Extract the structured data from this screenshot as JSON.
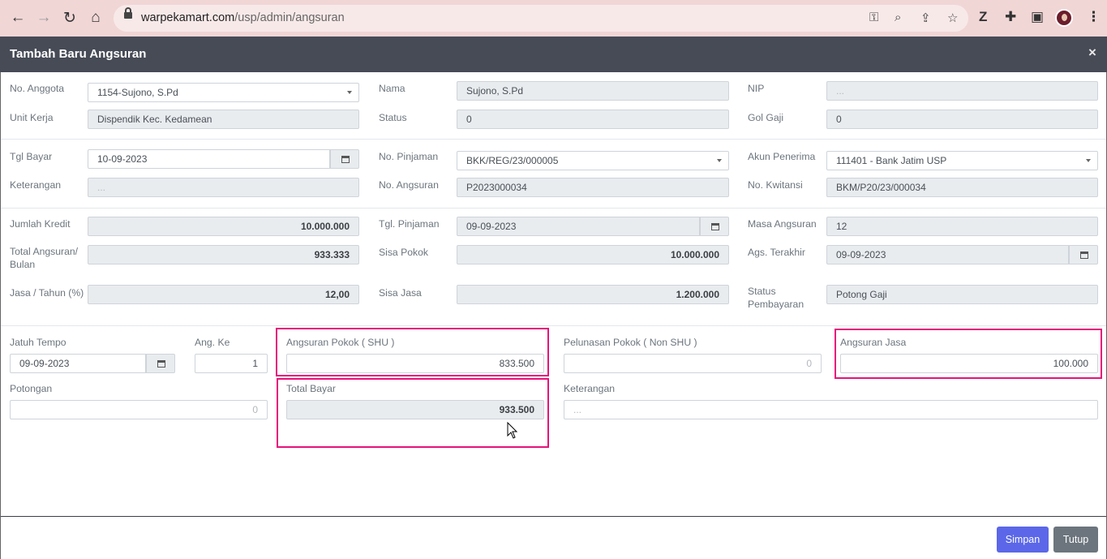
{
  "browser": {
    "url_domain": "warpekamart.com",
    "url_path": "/usp/admin/angsuran"
  },
  "modal": {
    "title": "Tambah Baru Angsuran",
    "close": "×"
  },
  "row1": {
    "no_anggota_label": "No. Anggota",
    "no_anggota_value": "1154-Sujono, S.Pd",
    "nama_label": "Nama",
    "nama_value": "Sujono, S.Pd",
    "nip_label": "NIP",
    "nip_value": "...",
    "unit_kerja_label": "Unit Kerja",
    "unit_kerja_value": "Dispendik Kec. Kedamean",
    "status_label": "Status",
    "status_value": "0",
    "gol_gaji_label": "Gol Gaji",
    "gol_gaji_value": "0"
  },
  "row2": {
    "tgl_bayar_label": "Tgl Bayar",
    "tgl_bayar_value": "10-09-2023",
    "no_pinjaman_label": "No. Pinjaman",
    "no_pinjaman_value": "BKK/REG/23/000005",
    "akun_penerima_label": "Akun Penerima",
    "akun_penerima_value": "111401 - Bank Jatim USP",
    "keterangan_label": "Keterangan",
    "keterangan_value": "...",
    "no_angsuran_label": "No. Angsuran",
    "no_angsuran_value": "P2023000034",
    "no_kwitansi_label": "No. Kwitansi",
    "no_kwitansi_value": "BKM/P20/23/000034"
  },
  "row3": {
    "jumlah_kredit_label": "Jumlah Kredit",
    "jumlah_kredit_value": "10.000.000",
    "tgl_pinjaman_label": "Tgl. Pinjaman",
    "tgl_pinjaman_value": "09-09-2023",
    "masa_angsuran_label": "Masa Angsuran",
    "masa_angsuran_value": "12",
    "total_angsuran_label": "Total Angsuran/ Bulan",
    "total_angsuran_value": "933.333",
    "sisa_pokok_label": "Sisa Pokok",
    "sisa_pokok_value": "10.000.000",
    "ags_terakhir_label": "Ags. Terakhir",
    "ags_terakhir_value": "09-09-2023",
    "jasa_tahun_label": "Jasa / Tahun (%)",
    "jasa_tahun_value": "12,00",
    "sisa_jasa_label": "Sisa Jasa",
    "sisa_jasa_value": "1.200.000",
    "status_pembayaran_label": "Status Pembayaran",
    "status_pembayaran_value": "Potong Gaji"
  },
  "row4": {
    "jatuh_tempo_label": "Jatuh Tempo",
    "jatuh_tempo_value": "09-09-2023",
    "ang_ke_label": "Ang. Ke",
    "ang_ke_value": "1",
    "angsuran_pokok_label": "Angsuran Pokok ( SHU )",
    "angsuran_pokok_value": "833.500",
    "pelunasan_pokok_label": "Pelunasan Pokok ( Non SHU )",
    "pelunasan_pokok_value": "0",
    "angsuran_jasa_label": "Angsuran Jasa",
    "angsuran_jasa_value": "100.000",
    "potongan_label": "Potongan",
    "potongan_value": "0",
    "total_bayar_label": "Total Bayar",
    "total_bayar_value": "933.500",
    "keterangan_label": "Keterangan",
    "keterangan_value": "..."
  },
  "footer": {
    "save_label": "Simpan",
    "close_label": "Tutup"
  },
  "colors": {
    "highlight": "#e6137a",
    "primary": "#5b67e8",
    "secondary": "#6c757d",
    "header": "#464b56"
  }
}
